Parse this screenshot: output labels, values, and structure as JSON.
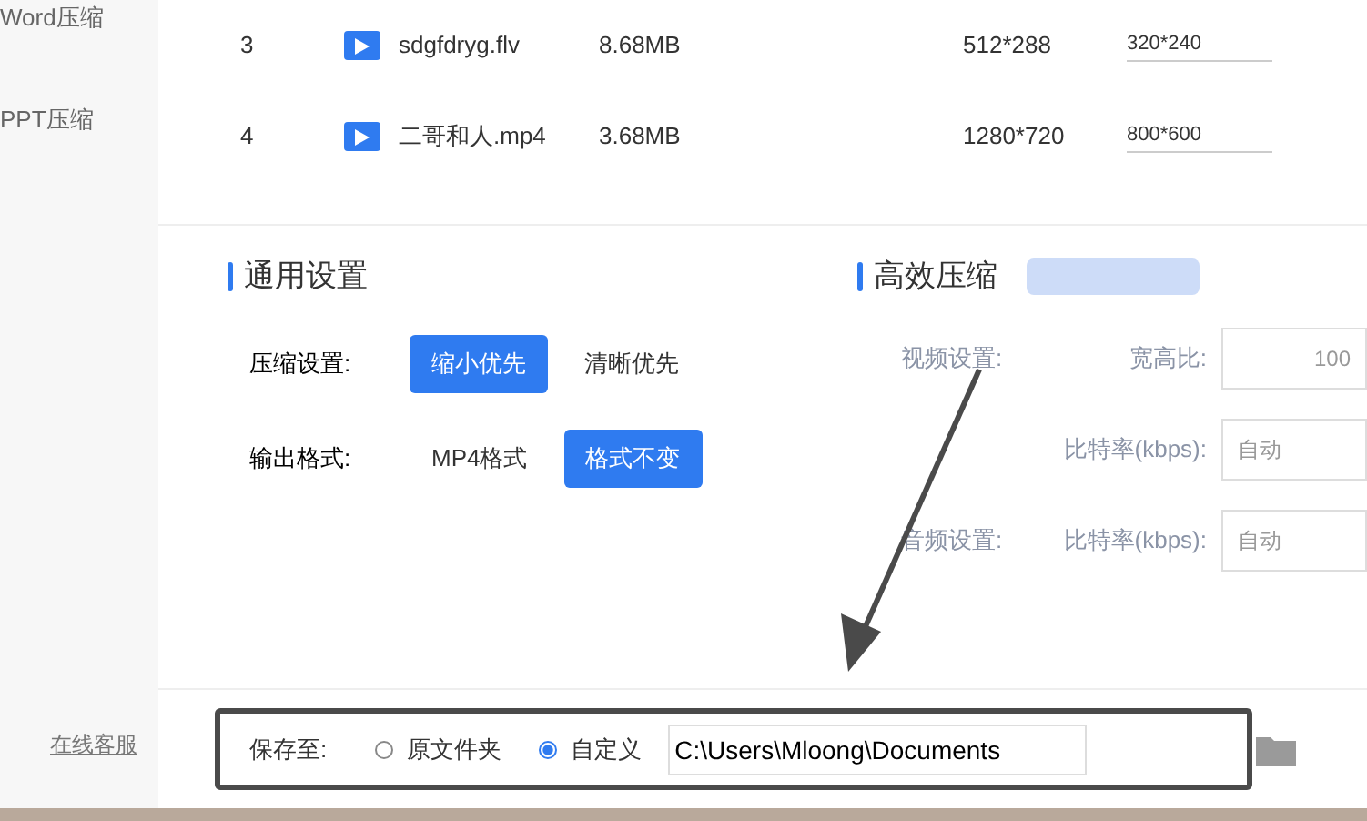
{
  "sidebar": {
    "items": [
      {
        "label": "Word压缩",
        "selected": false
      },
      {
        "label": "PPT压缩",
        "selected": false
      }
    ],
    "link": "在线客服"
  },
  "table": {
    "rows": [
      {
        "index": "3",
        "name": "sdgfdryg.flv",
        "size": "8.68MB",
        "resolution": "512*288",
        "target": "320*240"
      },
      {
        "index": "4",
        "name": "二哥和人.mp4",
        "size": "3.68MB",
        "resolution": "1280*720",
        "target": "800*600"
      }
    ]
  },
  "general": {
    "title": "通用设置",
    "settings": [
      {
        "label": "压缩设置:",
        "options": [
          {
            "label": "缩小优先",
            "selected": true
          },
          {
            "label": "清晰优先",
            "selected": false
          }
        ]
      },
      {
        "label": "输出格式:",
        "options": [
          {
            "label": "MP4格式",
            "selected": false
          },
          {
            "label": "格式不变",
            "selected": true
          }
        ]
      }
    ]
  },
  "efficient": {
    "title": "高效压缩",
    "rows": [
      {
        "group": "视频设置:",
        "label": "宽高比:",
        "value": "100",
        "placeholder": ""
      },
      {
        "group": "",
        "label": "比特率(kbps):",
        "value": "",
        "placeholder": "自动"
      },
      {
        "group": "音频设置:",
        "label": "比特率(kbps):",
        "value": "",
        "placeholder": "自动"
      }
    ]
  },
  "save": {
    "label": "保存至:",
    "options": [
      {
        "label": "原文件夹",
        "selected": false
      },
      {
        "label": "自定义",
        "selected": true
      }
    ],
    "path": "C:\\Users\\Mloong\\Documents"
  }
}
